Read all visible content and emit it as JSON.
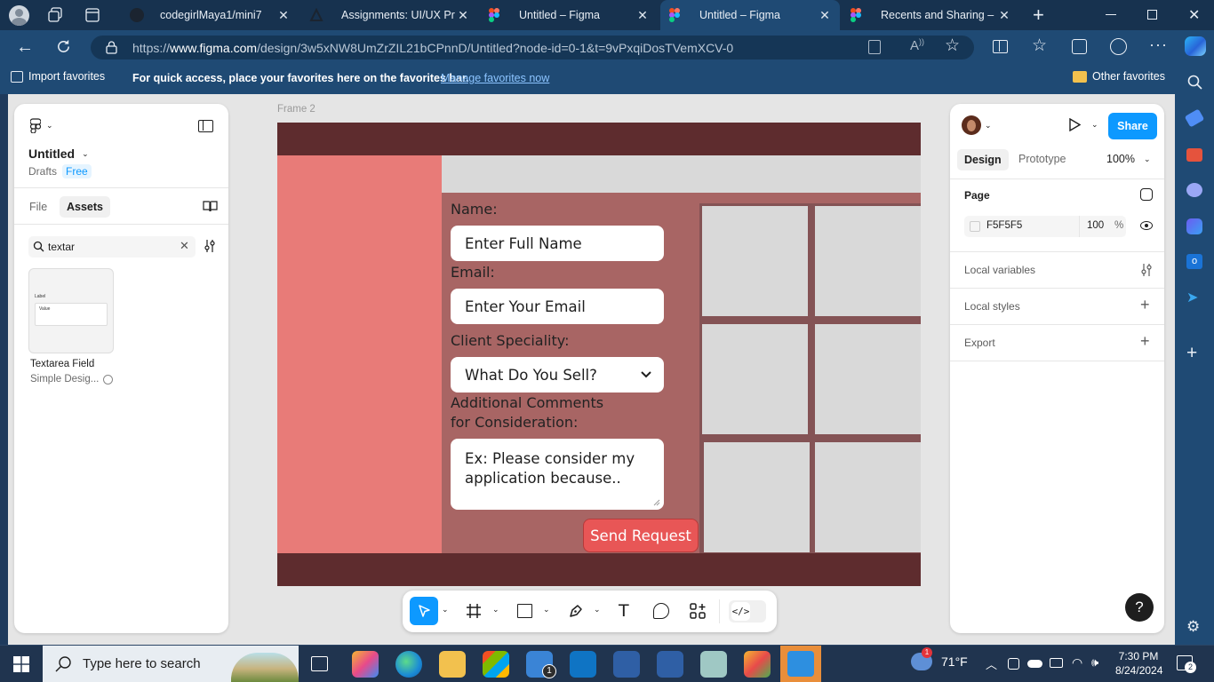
{
  "browser": {
    "tabs": [
      {
        "label": "codegirlMaya1/mini7",
        "icon": "github-icon"
      },
      {
        "label": "Assignments: UI/UX Princip",
        "icon": "canvas-icon"
      },
      {
        "label": "Untitled – Figma",
        "icon": "figma-icon"
      },
      {
        "label": "Untitled – Figma",
        "icon": "figma-icon",
        "active": true
      },
      {
        "label": "Recents and Sharing – Figm",
        "icon": "figma-icon"
      }
    ],
    "url_prefix": "https://",
    "url_host": "www.figma.com",
    "url_path": "/design/3w5xNW8UmZrZIL21bCPnnD/Untitled?node-id=0-1&t=9vPxqiDosTVemXCV-0",
    "favorites_bar": {
      "import": "Import favorites",
      "prompt": "For quick access, place your favorites here on the favorites bar.",
      "manage": "Manage favorites now",
      "other": "Other favorites"
    }
  },
  "figma": {
    "file_name": "Untitled",
    "location": "Drafts",
    "plan": "Free",
    "tabs": {
      "file": "File",
      "assets": "Assets"
    },
    "search_value": "textar",
    "asset": {
      "name": "Textarea Field",
      "library": "Simple Desig...",
      "thumb_label": "Label",
      "thumb_value": "Value"
    },
    "frame_label": "Frame 2",
    "form": {
      "name_label": "Name:",
      "name_placeholder": "Enter Full Name",
      "email_label": "Email:",
      "email_placeholder": "Enter Your Email",
      "speciality_label": "Client Speciality:",
      "speciality_value": "What Do You Sell?",
      "comments_label_1": "Additional Comments",
      "comments_label_2": "for Consideration:",
      "comments_placeholder_1": "Ex: Please consider my",
      "comments_placeholder_2": "application because..",
      "submit": "Send Request"
    },
    "right": {
      "share": "Share",
      "design": "Design",
      "prototype": "Prototype",
      "zoom": "100%",
      "page": "Page",
      "bg_color": "F5F5F5",
      "opacity": "100",
      "percent": "%",
      "local_variables": "Local variables",
      "local_styles": "Local styles",
      "export": "Export",
      "help": "?"
    },
    "colors": {
      "frame_header": "#5e2c2e",
      "frame_left": "#e87b78",
      "frame_body": "#a86564",
      "tile": "#d9d9d9",
      "button": "#e85656",
      "accent": "#0d99ff"
    }
  },
  "taskbar": {
    "search_placeholder": "Type here to search",
    "weather": "71°F",
    "time": "7:30 PM",
    "date": "8/24/2024",
    "notifications": "2",
    "mail_badge": "1",
    "weather_badge": "1"
  }
}
